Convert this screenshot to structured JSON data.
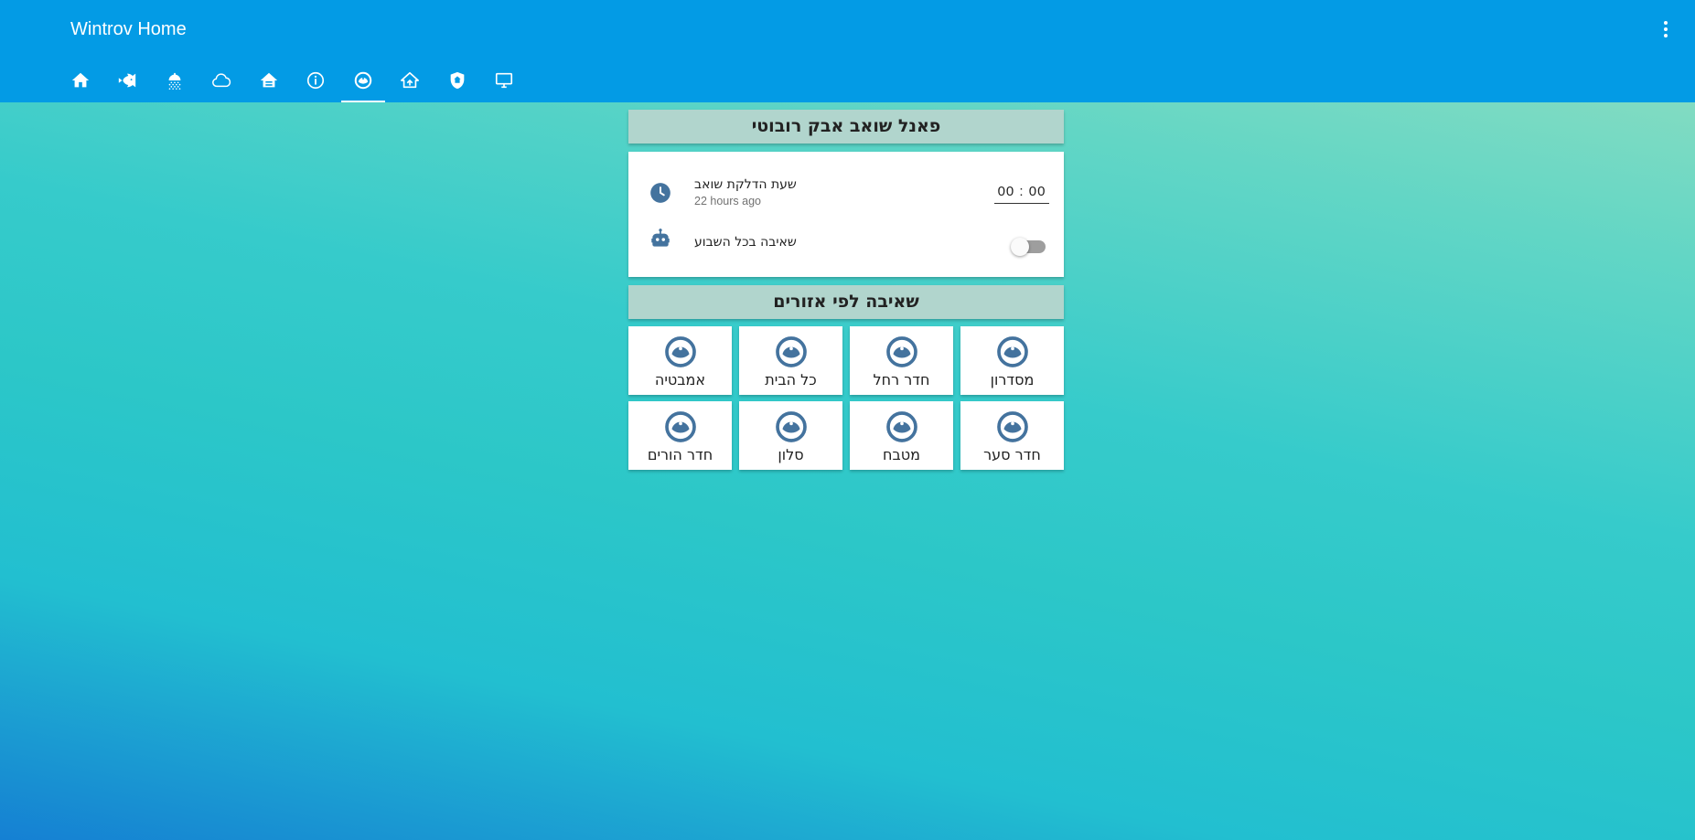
{
  "header": {
    "title": "Wintrov Home",
    "menu_icon": "dots-vertical-icon",
    "tabs": [
      {
        "icon": "home-icon"
      },
      {
        "icon": "fish-icon"
      },
      {
        "icon": "shower-icon"
      },
      {
        "icon": "cloud-icon"
      },
      {
        "icon": "home-floor-icon"
      },
      {
        "icon": "information-icon"
      },
      {
        "icon": "robot-vacuum-icon",
        "active": true
      },
      {
        "icon": "home-export-icon"
      },
      {
        "icon": "shield-home-icon"
      },
      {
        "icon": "monitor-icon"
      }
    ]
  },
  "panel": {
    "title": "פאנל שואב אבק רובוטי",
    "rows": [
      {
        "name": "שעת הדלקת שואב",
        "secondary": "22 hours ago",
        "icon": "clock-icon",
        "value": "00 : 00"
      },
      {
        "name": "שאיבה בכל השבוע",
        "icon": "robot-icon",
        "toggle_on": false
      }
    ]
  },
  "zones": {
    "title": "שאיבה לפי אזורים",
    "icon": "robot-vacuum-icon",
    "items": [
      {
        "label": "מסדרון"
      },
      {
        "label": "חדר רחל"
      },
      {
        "label": "כל הבית"
      },
      {
        "label": "אמבטיה"
      },
      {
        "label": "חדר סער"
      },
      {
        "label": "מטבח"
      },
      {
        "label": "סלון"
      },
      {
        "label": "חדר הורים"
      }
    ]
  },
  "colors": {
    "header": "#039be5",
    "section_title_bg": "#b1d5cd",
    "icon": "#44739e",
    "tab_icon": "#ffffff"
  }
}
